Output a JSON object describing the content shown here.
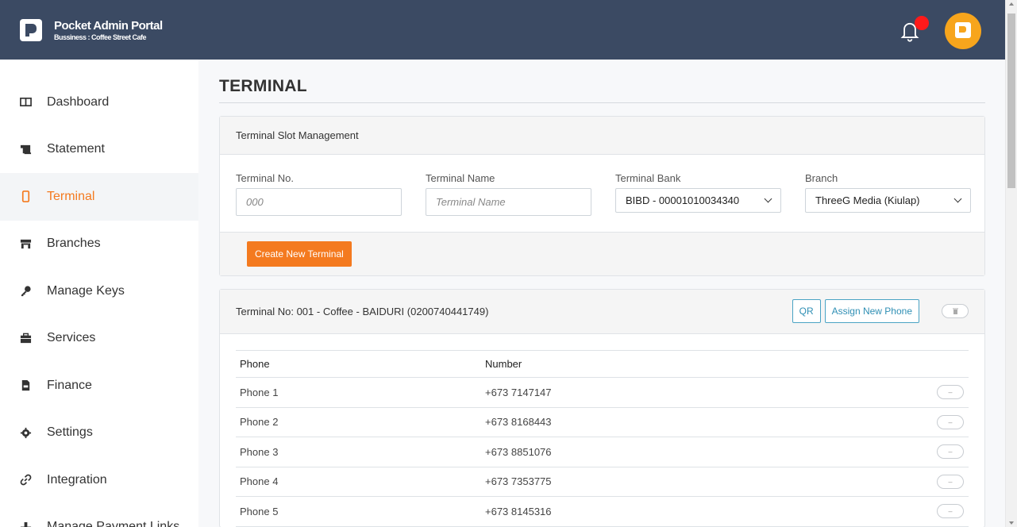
{
  "header": {
    "title": "Pocket Admin Portal",
    "subtitle": "Bussiness : Coffee Street Cafe",
    "bell_icon": "bell-icon",
    "notification_dot_color": "#ff1a1a",
    "avatar_color": "#f7a51c"
  },
  "sidebar": {
    "items": [
      {
        "label": "Dashboard",
        "icon": "columns-icon",
        "active": false
      },
      {
        "label": "Statement",
        "icon": "scroll-icon",
        "active": false
      },
      {
        "label": "Terminal",
        "icon": "mobile-icon",
        "active": true
      },
      {
        "label": "Branches",
        "icon": "store-icon",
        "active": false
      },
      {
        "label": "Manage Keys",
        "icon": "key-icon",
        "active": false
      },
      {
        "label": "Services",
        "icon": "briefcase-icon",
        "active": false
      },
      {
        "label": "Finance",
        "icon": "file-invoice-icon",
        "active": false
      },
      {
        "label": "Settings",
        "icon": "gear-icon",
        "active": false
      },
      {
        "label": "Integration",
        "icon": "link-icon",
        "active": false
      },
      {
        "label": "Manage Payment Links",
        "icon": "tools-icon",
        "active": false
      }
    ]
  },
  "main": {
    "title": "TERMINAL",
    "slot_card": {
      "title": "Terminal Slot Management",
      "terminal_no_label": "Terminal No.",
      "terminal_no_placeholder": "000",
      "terminal_name_label": "Terminal Name",
      "terminal_name_placeholder": "Terminal Name",
      "bank_label": "Terminal Bank",
      "bank_value": "BIBD - 00001010034340",
      "branch_label": "Branch",
      "branch_value": "ThreeG Media (Kiulap)",
      "create_button": "Create New Terminal"
    },
    "terminal_card": {
      "title": "Terminal No: 001 - Coffee - BAIDURI (0200740441749)",
      "qr_button": "QR",
      "assign_button": "Assign New Phone",
      "columns": [
        "Phone",
        "Number"
      ],
      "rows": [
        {
          "phone": "Phone 1",
          "number": "+673 7147147"
        },
        {
          "phone": "Phone 2",
          "number": "+673 8168443"
        },
        {
          "phone": "Phone 3",
          "number": "+673 8851076"
        },
        {
          "phone": "Phone 4",
          "number": "+673 7353775"
        },
        {
          "phone": "Phone 5",
          "number": "+673 8145316"
        }
      ]
    }
  },
  "colors": {
    "header_bg": "#3b4a63",
    "accent": "#f47a1f",
    "outline_button": "#2f8fb4"
  }
}
